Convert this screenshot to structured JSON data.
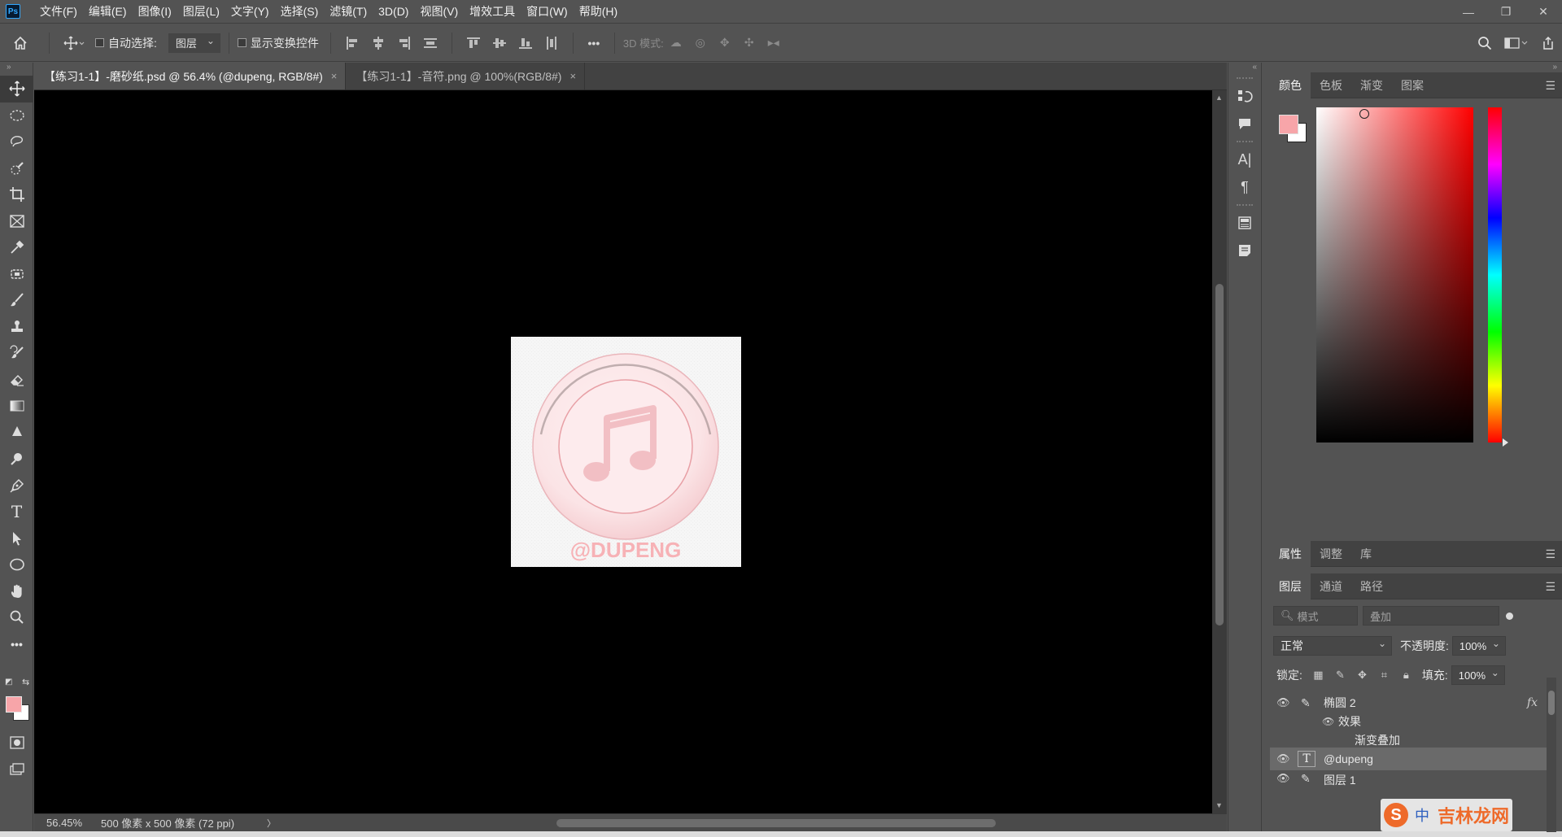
{
  "app": {
    "logo_text": "Ps"
  },
  "menubar": {
    "items": [
      "文件(F)",
      "编辑(E)",
      "图像(I)",
      "图层(L)",
      "文字(Y)",
      "选择(S)",
      "滤镜(T)",
      "3D(D)",
      "视图(V)",
      "增效工具",
      "窗口(W)",
      "帮助(H)"
    ]
  },
  "window_controls": {
    "minimize": "—",
    "restore": "❐",
    "close": "✕"
  },
  "optionsbar": {
    "auto_select_label": "自动选择:",
    "auto_select_value": "图层",
    "show_transform_label": "显示变换控件",
    "more_label": "•••",
    "mode_3d_label": "3D 模式:"
  },
  "tabs": [
    {
      "title": "【练习1-1】-磨砂纸.psd @ 56.4% (@dupeng, RGB/8#)",
      "close": "×",
      "active": true
    },
    {
      "title": "【练习1-1】-音符.png @ 100%(RGB/8#)",
      "close": "×",
      "active": false
    }
  ],
  "canvas": {
    "artwork_text": "@DUPENG",
    "colors": {
      "background": "#000000",
      "paper": "#f7f7f7",
      "pink": "#f7a5a9",
      "ring": "#f3c3c7"
    }
  },
  "status": {
    "zoom": "56.45%",
    "doc_info": "500 像素 x 500 像素 (72 ppi)",
    "arrow": "〉"
  },
  "color_panel": {
    "tabs": [
      "颜色",
      "色板",
      "渐变",
      "图案"
    ],
    "foreground": "#f7a5a9",
    "background": "#ffffff",
    "hue_color": "#ff0000"
  },
  "props_panel": {
    "tabs": [
      "属性",
      "调整",
      "库"
    ]
  },
  "layers_panel": {
    "tabs": [
      "图层",
      "通道",
      "路径"
    ],
    "filter_placeholder": "模式",
    "filter_value": "叠加",
    "blend_mode": "正常",
    "opacity_label": "不透明度:",
    "opacity_value": "100%",
    "lock_label": "锁定:",
    "fill_label": "填充:",
    "fill_value": "100%",
    "layers": [
      {
        "name": "椭圆 2",
        "type": "shape",
        "fx": "fx"
      },
      {
        "name": "效果",
        "type": "effects"
      },
      {
        "name": "渐变叠加",
        "type": "effect"
      },
      {
        "name": "@dupeng",
        "type": "text",
        "selected": true
      },
      {
        "name": "图层 1",
        "type": "shape"
      }
    ]
  },
  "watermark": {
    "ime": "中",
    "site": "吉林龙网"
  }
}
